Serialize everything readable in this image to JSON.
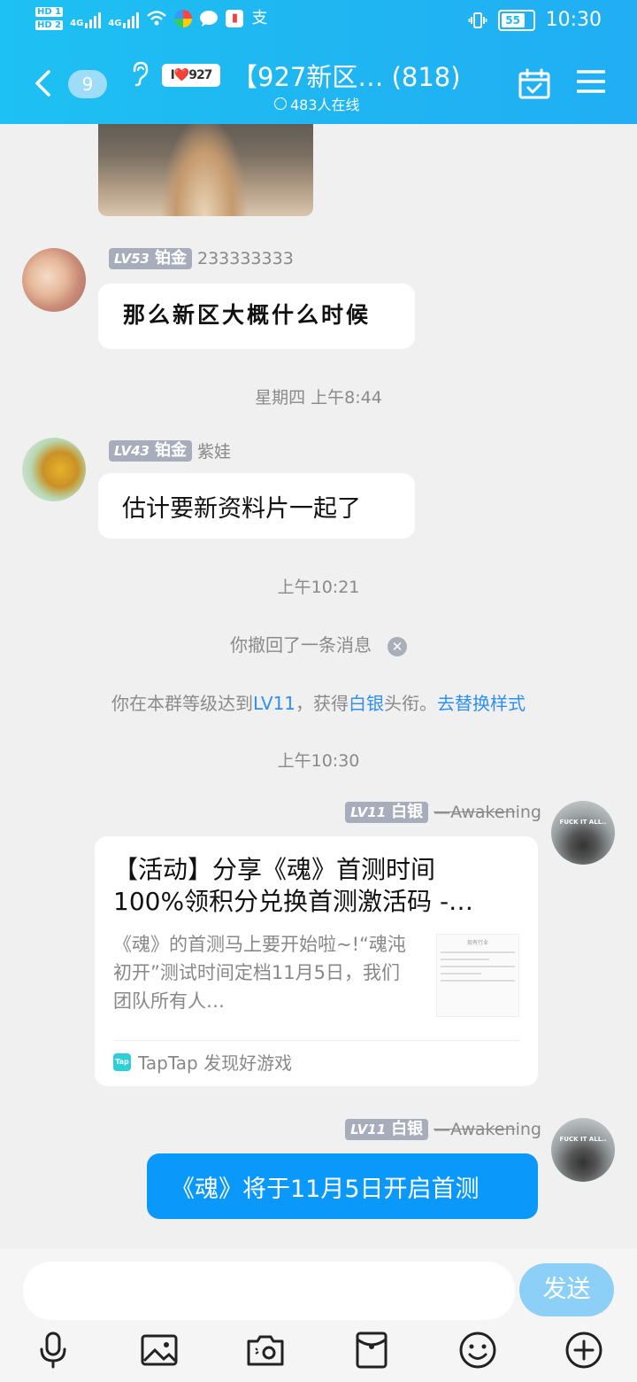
{
  "status_bar": {
    "hd_top": "HD 1",
    "hd_bottom": "HD 2",
    "net1": "4G",
    "net2": "4G",
    "battery": "55",
    "time": "10:30",
    "app_badge": "支"
  },
  "header": {
    "unread_count": "9",
    "group_tag": "I❤️927",
    "title": "【927新区… (818)",
    "online": "483人在线"
  },
  "messages": {
    "m1": {
      "level": "LV53",
      "rank": "铂金",
      "name": "233333333",
      "text": "那么新区大概什么时候"
    },
    "t1": "星期四 上午8:44",
    "m2": {
      "level": "LV43",
      "rank": "铂金",
      "name": "紫娃",
      "text": "估计要新资料片一起了"
    },
    "t2": "上午10:21",
    "recall": "你撤回了一条消息",
    "levelup": {
      "prefix": "你在本群等级达到",
      "level": "LV11",
      "mid": "，获得",
      "rank": "白银",
      "suffix": "头衔。",
      "link": "去替换样式"
    },
    "t3": "上午10:30",
    "m3": {
      "level": "LV11",
      "rank": "白银",
      "name_strike": "—Awaken",
      "name_rest": "ing",
      "avatar_text": "FUCK IT ALL..",
      "card_title_line1": "【活动】分享《魂》首测时间",
      "card_title_line2": "100%领积分兑换首测激活码 -…",
      "card_desc": "《魂》的首测马上要开始啦~!“魂沌初开”测试时间定档11月5日，我们团队所有人…",
      "thumb_title": "现有行业",
      "source_logo": "Tap",
      "source": "TapTap 发现好游戏"
    },
    "m4": {
      "level": "LV11",
      "rank": "白银",
      "name_strike": "—Awaken",
      "name_rest": "ing",
      "avatar_text": "FUCK IT ALL..",
      "text": "《魂》将于11月5日开启首测"
    }
  },
  "input": {
    "placeholder": "",
    "send_label": "发送"
  },
  "toolbar": {
    "icons": [
      "microphone-icon",
      "image-icon",
      "camera-icon",
      "red-packet-icon",
      "emoji-icon",
      "plus-icon"
    ]
  },
  "colors": {
    "header_bg": "#1fb6f2",
    "my_bubble": "#0a99fb",
    "link": "#2f8ff2",
    "send_button": "#8ccff7"
  }
}
